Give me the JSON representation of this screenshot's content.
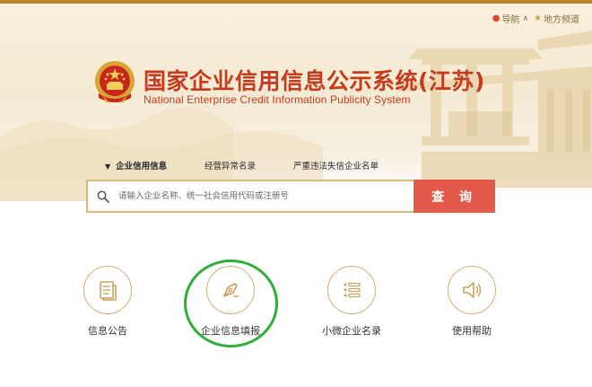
{
  "header": {
    "links": [
      {
        "label": "导航",
        "icon": "pin-icon"
      },
      {
        "label": "地方频道",
        "icon": "star-icon"
      }
    ],
    "title_cn": "国家企业信用信息公示系统(江苏)",
    "title_en": "National Enterprise Credit Information Publicity System"
  },
  "tabs": [
    {
      "label": "企业信用信息",
      "active": true
    },
    {
      "label": "经营异常名录",
      "active": false
    },
    {
      "label": "严重违法失信企业名单",
      "active": false
    }
  ],
  "search": {
    "placeholder": "请输入企业名称、统一社会信用代码或注册号",
    "button_label": "查 询"
  },
  "features": [
    {
      "label": "信息公告",
      "icon": "notice-document-icon"
    },
    {
      "label": "企业信息填报",
      "icon": "pen-nib-icon",
      "highlighted": true
    },
    {
      "label": "小微企业名录",
      "icon": "list-icon"
    },
    {
      "label": "使用帮助",
      "icon": "speaker-icon"
    }
  ],
  "colors": {
    "brand_red": "#c63a1e",
    "gold": "#b8862f",
    "search_button": "#e35a4a",
    "highlight_green": "#2fae3a"
  }
}
